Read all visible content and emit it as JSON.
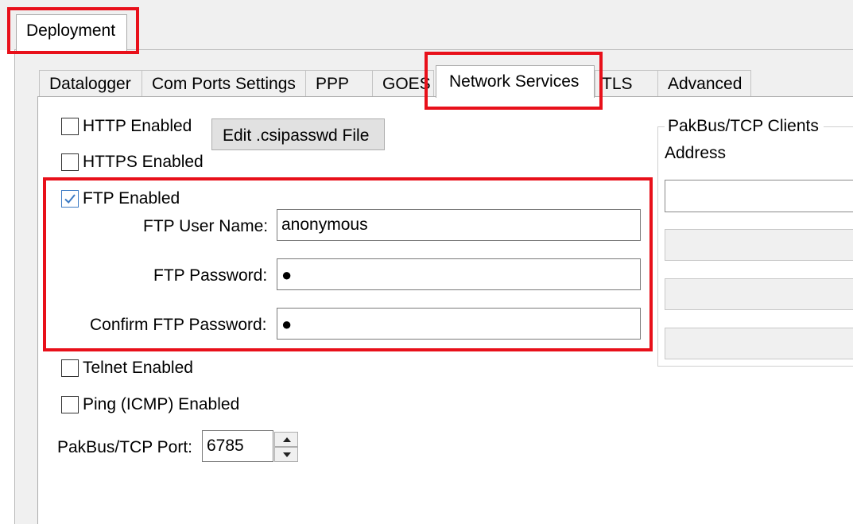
{
  "top_tab": {
    "label": "Deployment"
  },
  "tabs": [
    {
      "label": "Datalogger"
    },
    {
      "label": "Com Ports Settings"
    },
    {
      "label": "PPP"
    },
    {
      "label": "GOES"
    },
    {
      "label": "Network Services"
    },
    {
      "label": "TLS"
    },
    {
      "label": "Advanced"
    }
  ],
  "services": {
    "http_label": "HTTP Enabled",
    "https_label": "HTTPS Enabled",
    "edit_button_label": "Edit .csipasswd File",
    "ftp_label": "FTP Enabled",
    "ftp_checked": true,
    "ftp_user_label": "FTP User Name:",
    "ftp_user_value": "anonymous",
    "ftp_password_label": "FTP Password:",
    "ftp_password_value": "●",
    "ftp_confirm_label": "Confirm FTP Password:",
    "ftp_confirm_value": "●",
    "telnet_label": "Telnet Enabled",
    "ping_label": "Ping (ICMP) Enabled",
    "port_label": "PakBus/TCP Port:",
    "port_value": "6785"
  },
  "clients": {
    "group_title": "PakBus/TCP Clients",
    "address_header": "Address"
  },
  "icons": {
    "checkmark": "checkmark-icon",
    "spin_up": "arrow-up-icon",
    "spin_down": "arrow-down-icon"
  },
  "highlight_color": "#e8101a",
  "check_color": "#3d7bc4"
}
